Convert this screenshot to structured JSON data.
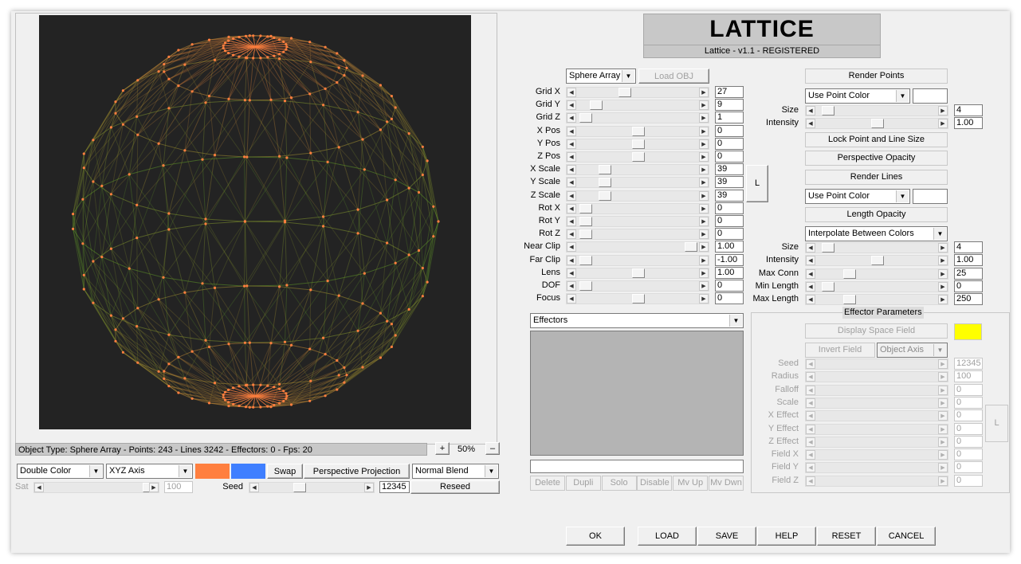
{
  "app": {
    "logo": "LATTICE",
    "version": "Lattice - v1.1 - REGISTERED"
  },
  "colors": {
    "swatch1": "#ff7f3f",
    "swatch2": "#3f7fff",
    "field_color": "#ffff00"
  },
  "status": {
    "text": "Object Type: Sphere Array - Points: 243 - Lines 3242 - Effectors: 0 - Fps: 20",
    "zoom": "50%",
    "zoom_in": "+",
    "zoom_out": "–"
  },
  "color_row": {
    "color_mode": "Double Color",
    "axis": "XYZ Axis",
    "swap": "Swap",
    "projection": "Perspective Projection",
    "blend": "Normal Blend"
  },
  "seed_row": {
    "sat_label": "Sat",
    "sat_value": "100",
    "seed_label": "Seed",
    "seed_value": "12345",
    "reseed": "Reseed"
  },
  "array": {
    "type": "Sphere Array",
    "load_obj": "Load OBJ",
    "lock_btn": "L",
    "params": [
      {
        "label": "Grid X",
        "value": "27",
        "pos": 0.38
      },
      {
        "label": "Grid Y",
        "value": "9",
        "pos": 0.12
      },
      {
        "label": "Grid Z",
        "value": "1",
        "pos": 0.03
      },
      {
        "label": "X Pos",
        "value": "0",
        "pos": 0.5
      },
      {
        "label": "Y Pos",
        "value": "0",
        "pos": 0.5
      },
      {
        "label": "Z Pos",
        "value": "0",
        "pos": 0.5
      },
      {
        "label": "X Scale",
        "value": "39",
        "pos": 0.2
      },
      {
        "label": "Y Scale",
        "value": "39",
        "pos": 0.2
      },
      {
        "label": "Z Scale",
        "value": "39",
        "pos": 0.2
      },
      {
        "label": "Rot X",
        "value": "0",
        "pos": 0.03
      },
      {
        "label": "Rot Y",
        "value": "0",
        "pos": 0.03
      },
      {
        "label": "Rot Z",
        "value": "0",
        "pos": 0.03
      },
      {
        "label": "Near Clip",
        "value": "1.00",
        "pos": 0.97
      },
      {
        "label": "Far Clip",
        "value": "-1.00",
        "pos": 0.03
      },
      {
        "label": "Lens",
        "value": "1.00",
        "pos": 0.5
      },
      {
        "label": "DOF",
        "value": "0",
        "pos": 0.03
      },
      {
        "label": "Focus",
        "value": "0",
        "pos": 0.5
      }
    ]
  },
  "points": {
    "render": "Render Points",
    "color_mode": "Use Point Color",
    "params": [
      {
        "label": "Size",
        "value": "4",
        "pos": 0.06
      },
      {
        "label": "Intensity",
        "value": "1.00",
        "pos": 0.5
      }
    ],
    "lock": "Lock Point and Line Size",
    "perspective": "Perspective Opacity"
  },
  "lines": {
    "render": "Render Lines",
    "color_mode": "Use Point Color",
    "length_opacity": "Length Opacity",
    "interp": "Interpolate Between Colors",
    "params": [
      {
        "label": "Size",
        "value": "4",
        "pos": 0.06
      },
      {
        "label": "Intensity",
        "value": "1.00",
        "pos": 0.5
      },
      {
        "label": "Max Conn",
        "value": "25",
        "pos": 0.25
      },
      {
        "label": "Min Length",
        "value": "0",
        "pos": 0.06
      },
      {
        "label": "Max Length",
        "value": "250",
        "pos": 0.25
      }
    ]
  },
  "effectors": {
    "dropdown": "Effectors",
    "buttons": [
      "Delete",
      "Dupli",
      "Solo",
      "Disable",
      "Mv Up",
      "Mv Dwn"
    ]
  },
  "effector_params": {
    "title": "Effector Parameters",
    "display_field": "Display Space Field",
    "invert": "Invert Field",
    "axis": "Object Axis",
    "lock_btn": "L",
    "params": [
      {
        "label": "Seed",
        "value": "12345"
      },
      {
        "label": "Radius",
        "value": "100"
      },
      {
        "label": "Falloff",
        "value": "0"
      },
      {
        "label": "Scale",
        "value": "0"
      },
      {
        "label": "X Effect",
        "value": "0"
      },
      {
        "label": "Y Effect",
        "value": "0"
      },
      {
        "label": "Z Effect",
        "value": "0"
      },
      {
        "label": "Field X",
        "value": "0"
      },
      {
        "label": "Field Y",
        "value": "0"
      },
      {
        "label": "Field Z",
        "value": "0"
      }
    ]
  },
  "footer": {
    "buttons": [
      "OK",
      "LOAD",
      "SAVE",
      "HELP",
      "RESET",
      "CANCEL"
    ]
  }
}
